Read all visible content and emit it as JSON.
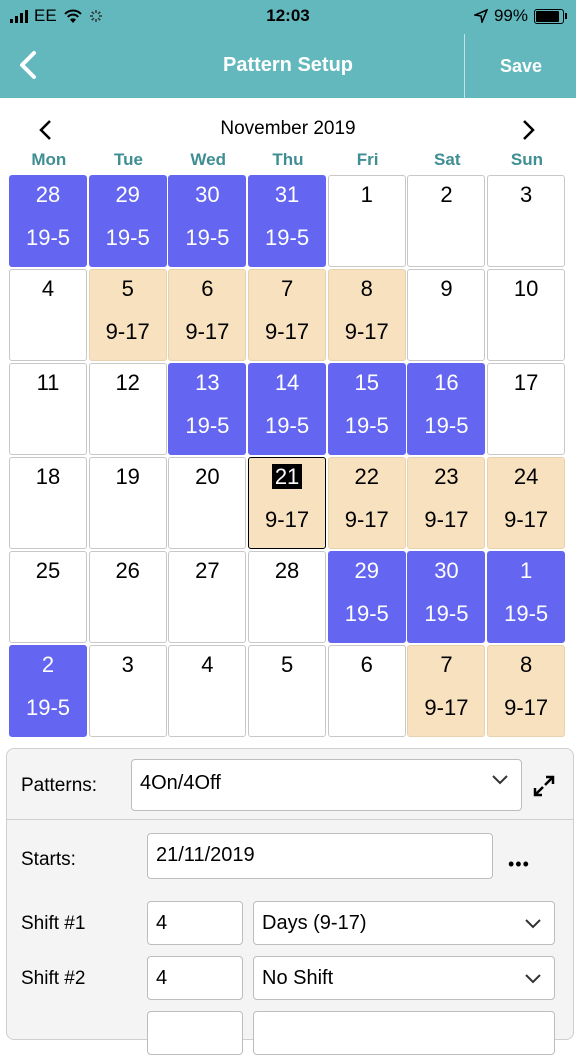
{
  "status": {
    "carrier": "EE",
    "time": "12:03",
    "battery": "99%"
  },
  "nav": {
    "title": "Pattern Setup",
    "save_label": "Save"
  },
  "calendar": {
    "month_label": "November 2019",
    "weekdays": [
      "Mon",
      "Tue",
      "Wed",
      "Thu",
      "Fri",
      "Sat",
      "Sun"
    ],
    "days": [
      {
        "d": "28",
        "s": "19-5",
        "t": "night"
      },
      {
        "d": "29",
        "s": "19-5",
        "t": "night"
      },
      {
        "d": "30",
        "s": "19-5",
        "t": "night"
      },
      {
        "d": "31",
        "s": "19-5",
        "t": "night"
      },
      {
        "d": "1",
        "s": "",
        "t": "none"
      },
      {
        "d": "2",
        "s": "",
        "t": "none"
      },
      {
        "d": "3",
        "s": "",
        "t": "none"
      },
      {
        "d": "4",
        "s": "",
        "t": "none"
      },
      {
        "d": "5",
        "s": "9-17",
        "t": "day"
      },
      {
        "d": "6",
        "s": "9-17",
        "t": "day"
      },
      {
        "d": "7",
        "s": "9-17",
        "t": "day"
      },
      {
        "d": "8",
        "s": "9-17",
        "t": "day"
      },
      {
        "d": "9",
        "s": "",
        "t": "none"
      },
      {
        "d": "10",
        "s": "",
        "t": "none"
      },
      {
        "d": "11",
        "s": "",
        "t": "none"
      },
      {
        "d": "12",
        "s": "",
        "t": "none"
      },
      {
        "d": "13",
        "s": "19-5",
        "t": "night"
      },
      {
        "d": "14",
        "s": "19-5",
        "t": "night"
      },
      {
        "d": "15",
        "s": "19-5",
        "t": "night"
      },
      {
        "d": "16",
        "s": "19-5",
        "t": "night"
      },
      {
        "d": "17",
        "s": "",
        "t": "none"
      },
      {
        "d": "18",
        "s": "",
        "t": "none"
      },
      {
        "d": "19",
        "s": "",
        "t": "none"
      },
      {
        "d": "20",
        "s": "",
        "t": "none"
      },
      {
        "d": "21",
        "s": "9-17",
        "t": "day",
        "selected": true
      },
      {
        "d": "22",
        "s": "9-17",
        "t": "day"
      },
      {
        "d": "23",
        "s": "9-17",
        "t": "day"
      },
      {
        "d": "24",
        "s": "9-17",
        "t": "day"
      },
      {
        "d": "25",
        "s": "",
        "t": "none"
      },
      {
        "d": "26",
        "s": "",
        "t": "none"
      },
      {
        "d": "27",
        "s": "",
        "t": "none"
      },
      {
        "d": "28",
        "s": "",
        "t": "none"
      },
      {
        "d": "29",
        "s": "19-5",
        "t": "night"
      },
      {
        "d": "30",
        "s": "19-5",
        "t": "night"
      },
      {
        "d": "1",
        "s": "19-5",
        "t": "night"
      },
      {
        "d": "2",
        "s": "19-5",
        "t": "night"
      },
      {
        "d": "3",
        "s": "",
        "t": "none"
      },
      {
        "d": "4",
        "s": "",
        "t": "none"
      },
      {
        "d": "5",
        "s": "",
        "t": "none"
      },
      {
        "d": "6",
        "s": "",
        "t": "none"
      },
      {
        "d": "7",
        "s": "9-17",
        "t": "day"
      },
      {
        "d": "8",
        "s": "9-17",
        "t": "day"
      }
    ]
  },
  "form": {
    "patterns_label": "Patterns:",
    "pattern_value": "4On/4Off",
    "starts_label": "Starts:",
    "starts_value": "21/11/2019",
    "more_label": "•••",
    "shifts": [
      {
        "label": "Shift #1",
        "count": "4",
        "shift": "Days (9-17)"
      },
      {
        "label": "Shift #2",
        "count": "4",
        "shift": "No Shift"
      }
    ]
  },
  "colors": {
    "header": "#62b8bd",
    "night": "#6466f1",
    "day": "#f7e1bf",
    "weekday": "#3f8e94"
  }
}
